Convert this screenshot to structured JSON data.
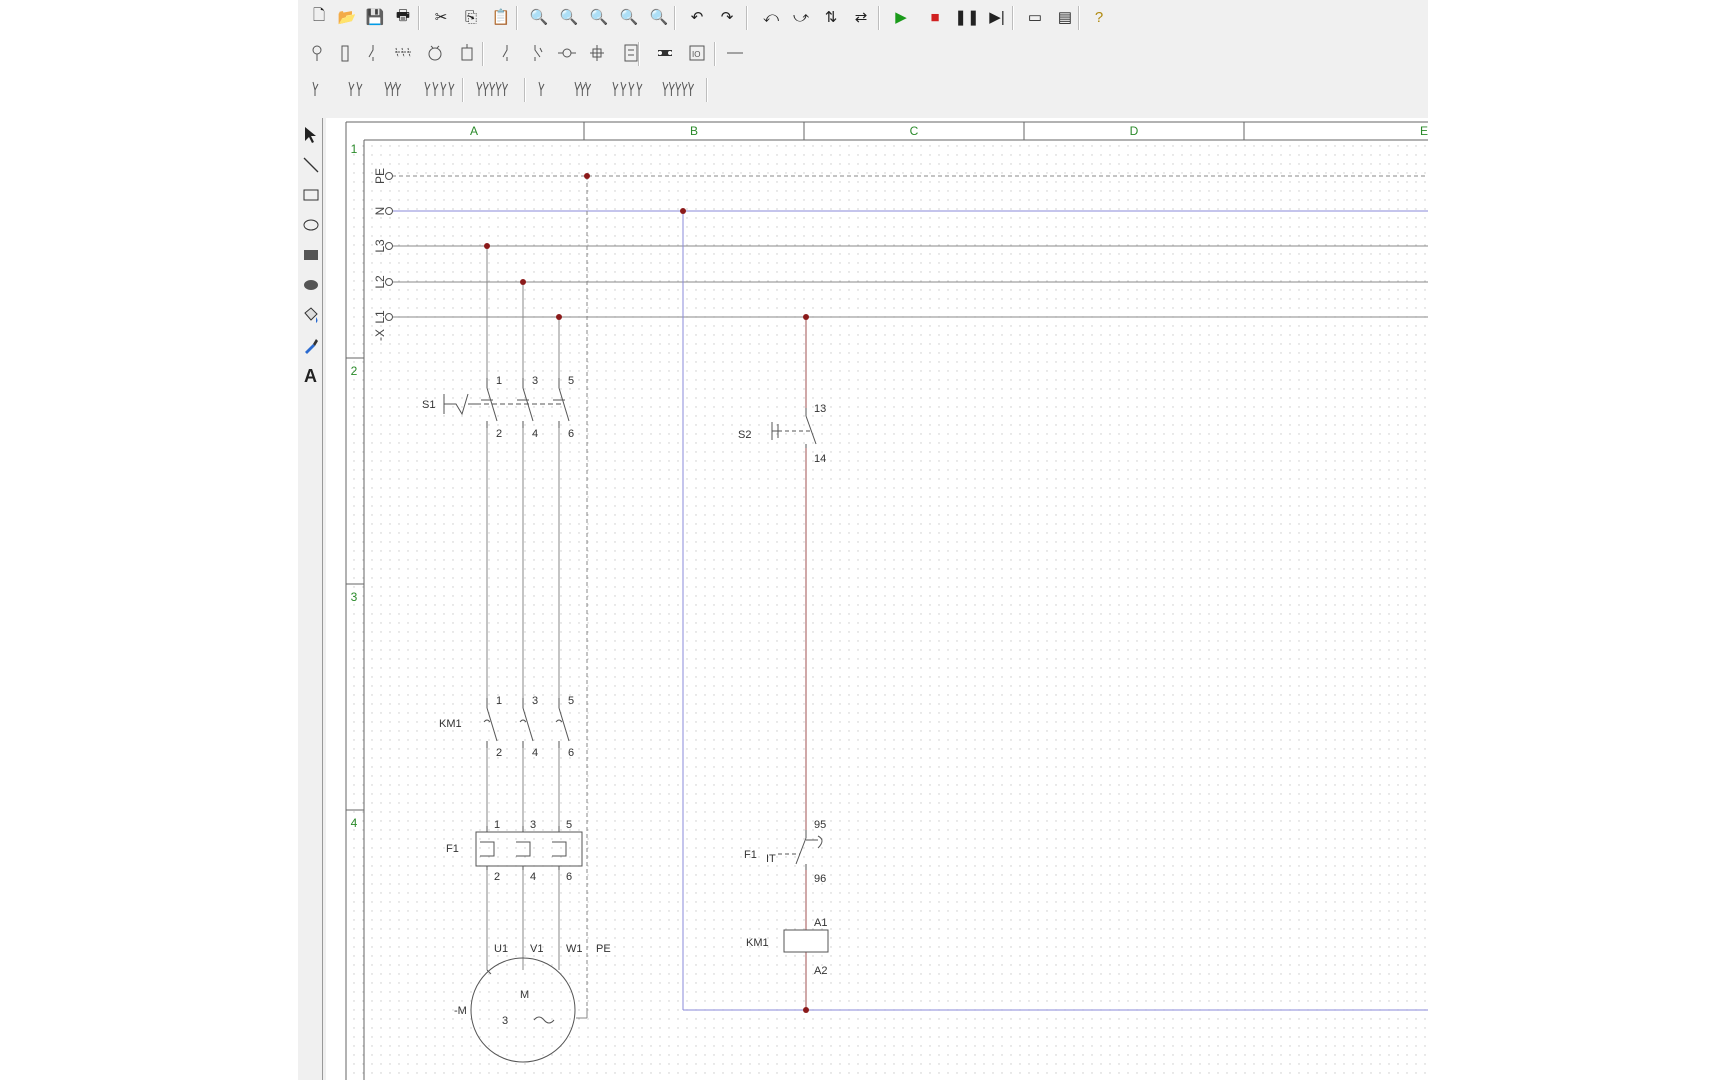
{
  "toolbar_main": [
    {
      "name": "new-file-icon",
      "glyph": "🗋"
    },
    {
      "name": "open-folder-icon",
      "glyph": "📂"
    },
    {
      "name": "save-icon",
      "glyph": "💾"
    },
    {
      "name": "print-icon",
      "glyph": "🖶"
    },
    {
      "name": "cut-icon",
      "glyph": "✂"
    },
    {
      "name": "copy-icon",
      "glyph": "⎘"
    },
    {
      "name": "paste-icon",
      "glyph": "📋"
    },
    {
      "name": "zoom-page-icon",
      "glyph": "🔍"
    },
    {
      "name": "zoom-width-icon",
      "glyph": "🔍"
    },
    {
      "name": "zoom-in-icon",
      "glyph": "🔍"
    },
    {
      "name": "zoom-out-icon",
      "glyph": "🔍"
    },
    {
      "name": "zoom-window-icon",
      "glyph": "🔍"
    },
    {
      "name": "undo-icon",
      "glyph": "↶"
    },
    {
      "name": "redo-icon",
      "glyph": "↷"
    },
    {
      "name": "rotate-left-icon",
      "glyph": "⤺"
    },
    {
      "name": "rotate-right-icon",
      "glyph": "⤻"
    },
    {
      "name": "flip-vertical-icon",
      "glyph": "⇅"
    },
    {
      "name": "flip-horizontal-icon",
      "glyph": "⇄"
    },
    {
      "name": "play-simulation-icon",
      "glyph": "▶"
    },
    {
      "name": "stop-simulation-icon",
      "glyph": "■"
    },
    {
      "name": "pause-simulation-icon",
      "glyph": "❚❚"
    },
    {
      "name": "step-simulation-icon",
      "glyph": "▶|"
    },
    {
      "name": "window-icon",
      "glyph": "▭"
    },
    {
      "name": "window-list-icon",
      "glyph": "▤"
    },
    {
      "name": "help-icon",
      "glyph": "?"
    }
  ],
  "toolbar_symbols": [
    {
      "name": "lamp-symbol-icon"
    },
    {
      "name": "fuse-symbol-icon"
    },
    {
      "name": "contact-symbol-icon"
    },
    {
      "name": "triple-contact-symbol-icon"
    },
    {
      "name": "motor-symbol-icon"
    },
    {
      "name": "coil-symbol-icon"
    },
    {
      "name": "no-contact-symbol-icon"
    },
    {
      "name": "nc-contact-symbol-icon"
    },
    {
      "name": "sensor-symbol-icon"
    },
    {
      "name": "terminal-symbol-icon"
    },
    {
      "name": "relay-symbol-icon"
    },
    {
      "name": "connector-symbol-icon"
    },
    {
      "name": "plc-io-symbol-icon"
    },
    {
      "name": "line-symbol-icon"
    }
  ],
  "toolbar_contacts": [
    {
      "name": "single-contact-icon"
    },
    {
      "name": "double-contact-icon"
    },
    {
      "name": "triple-contact-icon"
    },
    {
      "name": "quad-contact-icon"
    },
    {
      "name": "multi-contact-icon"
    },
    {
      "name": "nc-single-icon"
    },
    {
      "name": "nc-triple-icon"
    },
    {
      "name": "nc-quad-icon"
    },
    {
      "name": "nc-multi-icon"
    }
  ],
  "left_tools": [
    {
      "name": "select-arrow-icon"
    },
    {
      "name": "line-tool-icon"
    },
    {
      "name": "rectangle-tool-icon"
    },
    {
      "name": "ellipse-tool-icon"
    },
    {
      "name": "filled-rectangle-tool-icon"
    },
    {
      "name": "filled-ellipse-tool-icon"
    },
    {
      "name": "fill-bucket-icon"
    },
    {
      "name": "color-picker-icon"
    },
    {
      "name": "text-tool-icon"
    }
  ],
  "text_tool_glyph": "A",
  "columns": [
    "A",
    "B",
    "C",
    "D",
    "E"
  ],
  "rows": [
    "1",
    "2",
    "3",
    "4"
  ],
  "buses": [
    {
      "label": "PE"
    },
    {
      "label": "N"
    },
    {
      "label": "L3"
    },
    {
      "label": "L2"
    },
    {
      "label": "L1"
    }
  ],
  "terminal_strip": "-X",
  "components": {
    "s1": {
      "label": "S1",
      "top": [
        "1",
        "3",
        "5"
      ],
      "bottom": [
        "2",
        "4",
        "6"
      ]
    },
    "km1_main": {
      "label": "KM1",
      "top": [
        "1",
        "3",
        "5"
      ],
      "bottom": [
        "2",
        "4",
        "6"
      ]
    },
    "f1_main": {
      "label": "F1",
      "top": [
        "1",
        "3",
        "5"
      ],
      "bottom": [
        "2",
        "4",
        "6"
      ]
    },
    "motor": {
      "label": "-M",
      "terminals": [
        "U1",
        "V1",
        "W1",
        "PE"
      ],
      "m": "M",
      "phases": "3",
      "ac": "~"
    },
    "s2": {
      "label": "S2",
      "top": "13",
      "bottom": "14"
    },
    "f1_aux": {
      "label": "F1",
      "top": "95",
      "bottom": "96"
    },
    "km1_coil": {
      "label": "KM1",
      "top": "A1",
      "bottom": "A2"
    }
  },
  "colors": {
    "energized_wire": "#a05050",
    "neutral_wire": "#8a8ad8",
    "wire": "#888888",
    "node": "#8b1a1a",
    "grid_dot": "#c8c8c8",
    "column_text": "#2a8a2a"
  }
}
